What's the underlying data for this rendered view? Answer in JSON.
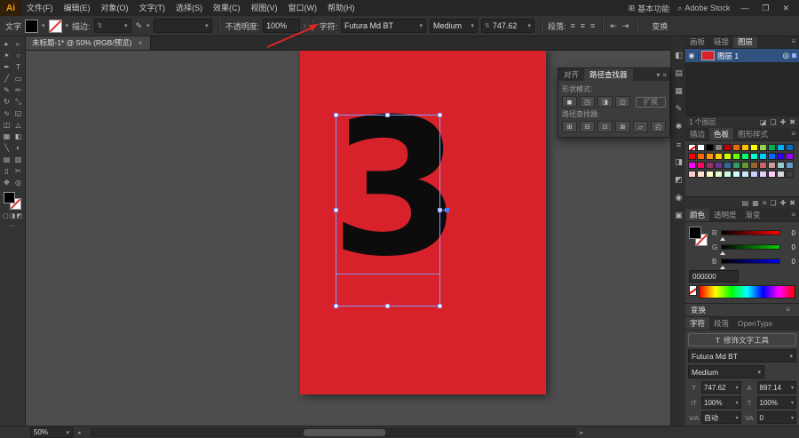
{
  "app": {
    "logo": "Ai",
    "workspace_label": "基本功能",
    "search_label": "Adobe Stock",
    "window": {
      "minimize": "—",
      "maximize": "❐",
      "close": "✕"
    }
  },
  "icons": {
    "chevron_down": "▾",
    "chevron_right": "›",
    "spinner": "⇅",
    "search": "⌕",
    "menu": "≡",
    "close": "×",
    "eye": "◉",
    "target": "◎",
    "workspace": "⊞",
    "brush": "✎",
    "align_left": "≡",
    "align_center": "≡",
    "align_right": "≡",
    "indent_left": "⇤",
    "indent_right": "⇥",
    "arrow_left": "◂",
    "arrow_right": "▸"
  },
  "menubar": {
    "items": [
      "文件(F)",
      "编辑(E)",
      "对象(O)",
      "文字(T)",
      "选择(S)",
      "效果(C)",
      "视图(V)",
      "窗口(W)",
      "帮助(H)"
    ]
  },
  "control_bar": {
    "object_label": "文字",
    "stroke_label": "描边:",
    "opacity_label": "不透明度:",
    "opacity_value": "100%",
    "character_label": "字符:",
    "font_name": "Futura Md BT",
    "font_style": "Medium",
    "font_size": "747.62",
    "paragraph_label": "段落:",
    "transform_label": "变换"
  },
  "doc_tab": {
    "title": "未标题-1* @ 50% (RGB/预览)"
  },
  "tools": [
    {
      "name": "selection-tool",
      "glyph": "▸"
    },
    {
      "name": "direct-selection-tool",
      "glyph": "▹"
    },
    {
      "name": "magic-wand-tool",
      "glyph": "✶"
    },
    {
      "name": "lasso-tool",
      "glyph": "○"
    },
    {
      "name": "pen-tool",
      "glyph": "✒"
    },
    {
      "name": "type-tool",
      "glyph": "T"
    },
    {
      "name": "line-segment-tool",
      "glyph": "╱"
    },
    {
      "name": "rectangle-tool",
      "glyph": "▭"
    },
    {
      "name": "paintbrush-tool",
      "glyph": "✎"
    },
    {
      "name": "pencil-tool",
      "glyph": "✏"
    },
    {
      "name": "rotate-tool",
      "glyph": "↻"
    },
    {
      "name": "scale-tool",
      "glyph": "⤡"
    },
    {
      "name": "width-tool",
      "glyph": "∿"
    },
    {
      "name": "free-transform-tool",
      "glyph": "◱"
    },
    {
      "name": "shape-builder-tool",
      "glyph": "◫"
    },
    {
      "name": "perspective-grid-tool",
      "glyph": "△"
    },
    {
      "name": "mesh-tool",
      "glyph": "▦"
    },
    {
      "name": "gradient-tool",
      "glyph": "◧"
    },
    {
      "name": "eyedropper-tool",
      "glyph": "╲"
    },
    {
      "name": "blend-tool",
      "glyph": "◐"
    },
    {
      "name": "symbol-sprayer-tool",
      "glyph": "▤"
    },
    {
      "name": "column-graph-tool",
      "glyph": "▥"
    },
    {
      "name": "artboard-tool",
      "glyph": "▯"
    },
    {
      "name": "slice-tool",
      "glyph": "✂"
    },
    {
      "name": "hand-tool",
      "glyph": "✥"
    },
    {
      "name": "zoom-tool",
      "glyph": "◎"
    }
  ],
  "canvas": {
    "glyph": "3",
    "artboard_color": "#d8222b",
    "selection_color": "#7d9dff"
  },
  "pathfinder": {
    "tab_align": "对齐",
    "tab_pathfinder": "路径查找器",
    "shape_modes_label": "形状模式:",
    "expand_label": "扩展",
    "pathfinder_label": "路径查找器:",
    "shape_icons": [
      {
        "name": "unite-icon",
        "glyph": "◼"
      },
      {
        "name": "minus-front-icon",
        "glyph": "◳"
      },
      {
        "name": "intersect-icon",
        "glyph": "◨"
      },
      {
        "name": "exclude-icon",
        "glyph": "◫"
      }
    ],
    "pf_icons": [
      {
        "name": "divide-icon",
        "glyph": "⊞"
      },
      {
        "name": "trim-icon",
        "glyph": "⊟"
      },
      {
        "name": "merge-icon",
        "glyph": "⊡"
      },
      {
        "name": "crop-icon",
        "glyph": "⊠"
      },
      {
        "name": "outline-icon",
        "glyph": "▱"
      },
      {
        "name": "minus-back-icon",
        "glyph": "◰"
      }
    ]
  },
  "right_strip": {
    "icons": [
      {
        "name": "color-panel-icon",
        "glyph": "◧"
      },
      {
        "name": "color-guide-icon",
        "glyph": "▤"
      },
      {
        "name": "swatches-icon",
        "glyph": "▦"
      },
      {
        "name": "brushes-icon",
        "glyph": "✎"
      },
      {
        "name": "symbols-icon",
        "glyph": "✱"
      },
      {
        "name": "stroke-icon",
        "glyph": "≡"
      },
      {
        "name": "gradient-icon",
        "glyph": "◨"
      },
      {
        "name": "transparency-icon",
        "glyph": "◩"
      },
      {
        "name": "appearance-icon",
        "glyph": "◉"
      },
      {
        "name": "graphic-styles-icon",
        "glyph": "▣"
      }
    ]
  },
  "panels": {
    "layers": {
      "tab_artboards": "画板",
      "tab_links": "链接",
      "tab_layers": "图层",
      "layer_name": "图层 1",
      "footer_count": "1 个图层",
      "footer_icons": [
        {
          "name": "make-clip-mask-icon",
          "glyph": "◪"
        },
        {
          "name": "new-sublayer-icon",
          "glyph": "❏"
        },
        {
          "name": "new-layer-icon",
          "glyph": "✚"
        },
        {
          "name": "delete-layer-icon",
          "glyph": "✖"
        }
      ]
    },
    "swatches": {
      "tab_stroke": "描边",
      "tab_swatches": "色板",
      "tab_styles": "图形样式",
      "colors": [
        "none",
        "#ffffff",
        "#000000",
        "#808080",
        "#c10000",
        "#e36c09",
        "#ffc000",
        "#ffff00",
        "#92d050",
        "#00b050",
        "#00b0f0",
        "#0070c0",
        "#ff0000",
        "#ff6600",
        "#ff9900",
        "#ffcc00",
        "#ccff00",
        "#66ff00",
        "#00ff66",
        "#00ffcc",
        "#00ccff",
        "#0066ff",
        "#3300ff",
        "#9900ff",
        "#ff00ff",
        "#ff0066",
        "#993366",
        "#663399",
        "#336699",
        "#339966",
        "#669933",
        "#996633",
        "#cc6666",
        "#cc9999",
        "#99cccc",
        "#6699cc",
        "#ffcccc",
        "#ffe5cc",
        "#ffffcc",
        "#e5ffcc",
        "#ccffe5",
        "#ccffff",
        "#cce5ff",
        "#ccccff",
        "#e5ccff",
        "#ffccff",
        "#d9d9d9",
        "#404040"
      ],
      "footer_icons": [
        {
          "name": "swatch-libraries-icon",
          "glyph": "▤"
        },
        {
          "name": "swatch-kinds-icon",
          "glyph": "▦"
        },
        {
          "name": "swatch-options-icon",
          "glyph": "≡"
        },
        {
          "name": "new-color-group-icon",
          "glyph": "❏"
        },
        {
          "name": "new-swatch-icon",
          "glyph": "✚"
        },
        {
          "name": "delete-swatch-icon",
          "glyph": "✖"
        }
      ]
    },
    "color": {
      "tab_color": "颜色",
      "tab_transparency": "透明度",
      "tab_gradient": "渐变",
      "r_label": "R",
      "g_label": "G",
      "b_label": "B",
      "r_value": "0",
      "g_value": "0",
      "b_value": "0",
      "hex": "000000"
    },
    "transform": {
      "title": "变换"
    },
    "character": {
      "tab_character": "字符",
      "tab_paragraph": "段落",
      "tab_opentype": "OpenType",
      "touch_tool": "修饰文字工具",
      "font_name": "Futura Md BT",
      "font_style": "Medium",
      "size": "747.62",
      "leading": "897.14",
      "v_scale": "100%",
      "h_scale": "100%",
      "kerning": "自动",
      "tracking": "0"
    }
  },
  "status": {
    "zoom": "50%"
  }
}
